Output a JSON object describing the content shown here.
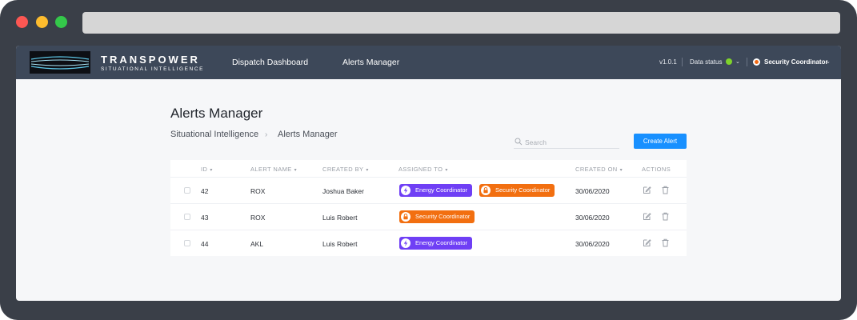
{
  "header": {
    "brand_name": "TRANSPOWER",
    "brand_subtitle": "SITUATIONAL INTELLIGENCE",
    "nav": [
      "Dispatch Dashboard",
      "Alerts Manager"
    ],
    "version": "v1.0.1",
    "data_status_label": "Data status",
    "data_status_color": "#7fd32b",
    "user_role": "Security Coordinator"
  },
  "page": {
    "title": "Alerts Manager",
    "breadcrumb": [
      "Situational Intelligence",
      "Alerts Manager"
    ],
    "search_placeholder": "Search",
    "create_button": "Create Alert"
  },
  "table": {
    "columns": [
      "ID",
      "ALERT NAME",
      "CREATED BY",
      "ASSIGNED TO",
      "CREATED ON",
      "ACTIONS"
    ],
    "rows": [
      {
        "id": "42",
        "name": "ROX",
        "created_by": "Joshua Baker",
        "assigned": [
          {
            "label": "Energy Coordinator",
            "icon": "lightning-icon",
            "color": "#6f3ff5"
          },
          {
            "label": "Security Coordinator",
            "icon": "lock-icon",
            "color": "#f26f10"
          }
        ],
        "created_on": "30/06/2020"
      },
      {
        "id": "43",
        "name": "ROX",
        "created_by": "Luis Robert",
        "assigned": [
          {
            "label": "Security Coordinator",
            "icon": "lock-icon",
            "color": "#f26f10"
          }
        ],
        "created_on": "30/06/2020"
      },
      {
        "id": "44",
        "name": "AKL",
        "created_by": "Luis Robert",
        "assigned": [
          {
            "label": "Energy Coordinator",
            "icon": "lightning-icon",
            "color": "#6f3ff5"
          }
        ],
        "created_on": "30/06/2020"
      }
    ]
  },
  "colors": {
    "header_bg": "#3d4859",
    "primary": "#1890ff",
    "energy": "#6f3ff5",
    "security": "#f26f10"
  }
}
